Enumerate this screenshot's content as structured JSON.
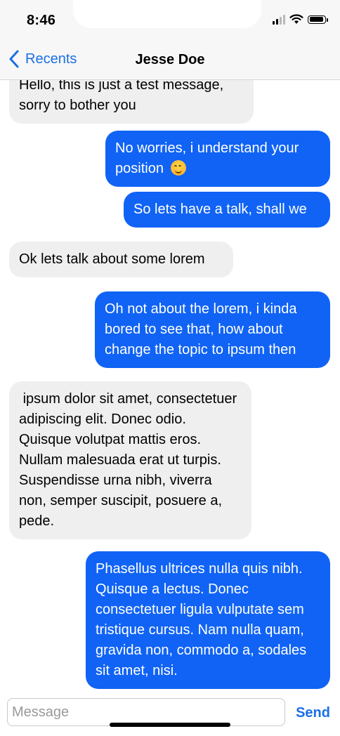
{
  "status_bar": {
    "time": "8:46"
  },
  "nav": {
    "back_label": "Recents",
    "title": "Jesse Doe"
  },
  "messages": [
    {
      "direction": "in",
      "text": "Hello, this is just a test message, sorry to bother you"
    },
    {
      "direction": "out",
      "text": "No worries, i understand your position",
      "emoji": "smiling-face"
    },
    {
      "direction": "out",
      "text": "So lets have a talk, shall we"
    },
    {
      "direction": "in",
      "text": "Ok lets talk about some lorem"
    },
    {
      "direction": "out",
      "text": "Oh not about the lorem, i kinda bored to see that, how about change the topic to ipsum then"
    },
    {
      "direction": "in",
      "text": " ipsum dolor sit amet, consectetuer adipiscing elit. Donec odio. Quisque volutpat mattis eros. Nullam malesuada erat ut turpis. Suspendisse urna nibh, viverra non, semper suscipit, posuere a, pede."
    },
    {
      "direction": "out",
      "text": "Phasellus ultrices nulla quis nibh. Quisque a lectus. Donec consectetuer ligula vulputate sem tristique cursus. Nam nulla quam, gravida non, commodo a, sodales sit amet, nisi."
    }
  ],
  "composer": {
    "placeholder": "Message",
    "send_label": "Send"
  },
  "colors": {
    "accent": "#1a6fe6",
    "outgoing_bubble": "#1063f5",
    "incoming_bubble": "#efefef"
  }
}
